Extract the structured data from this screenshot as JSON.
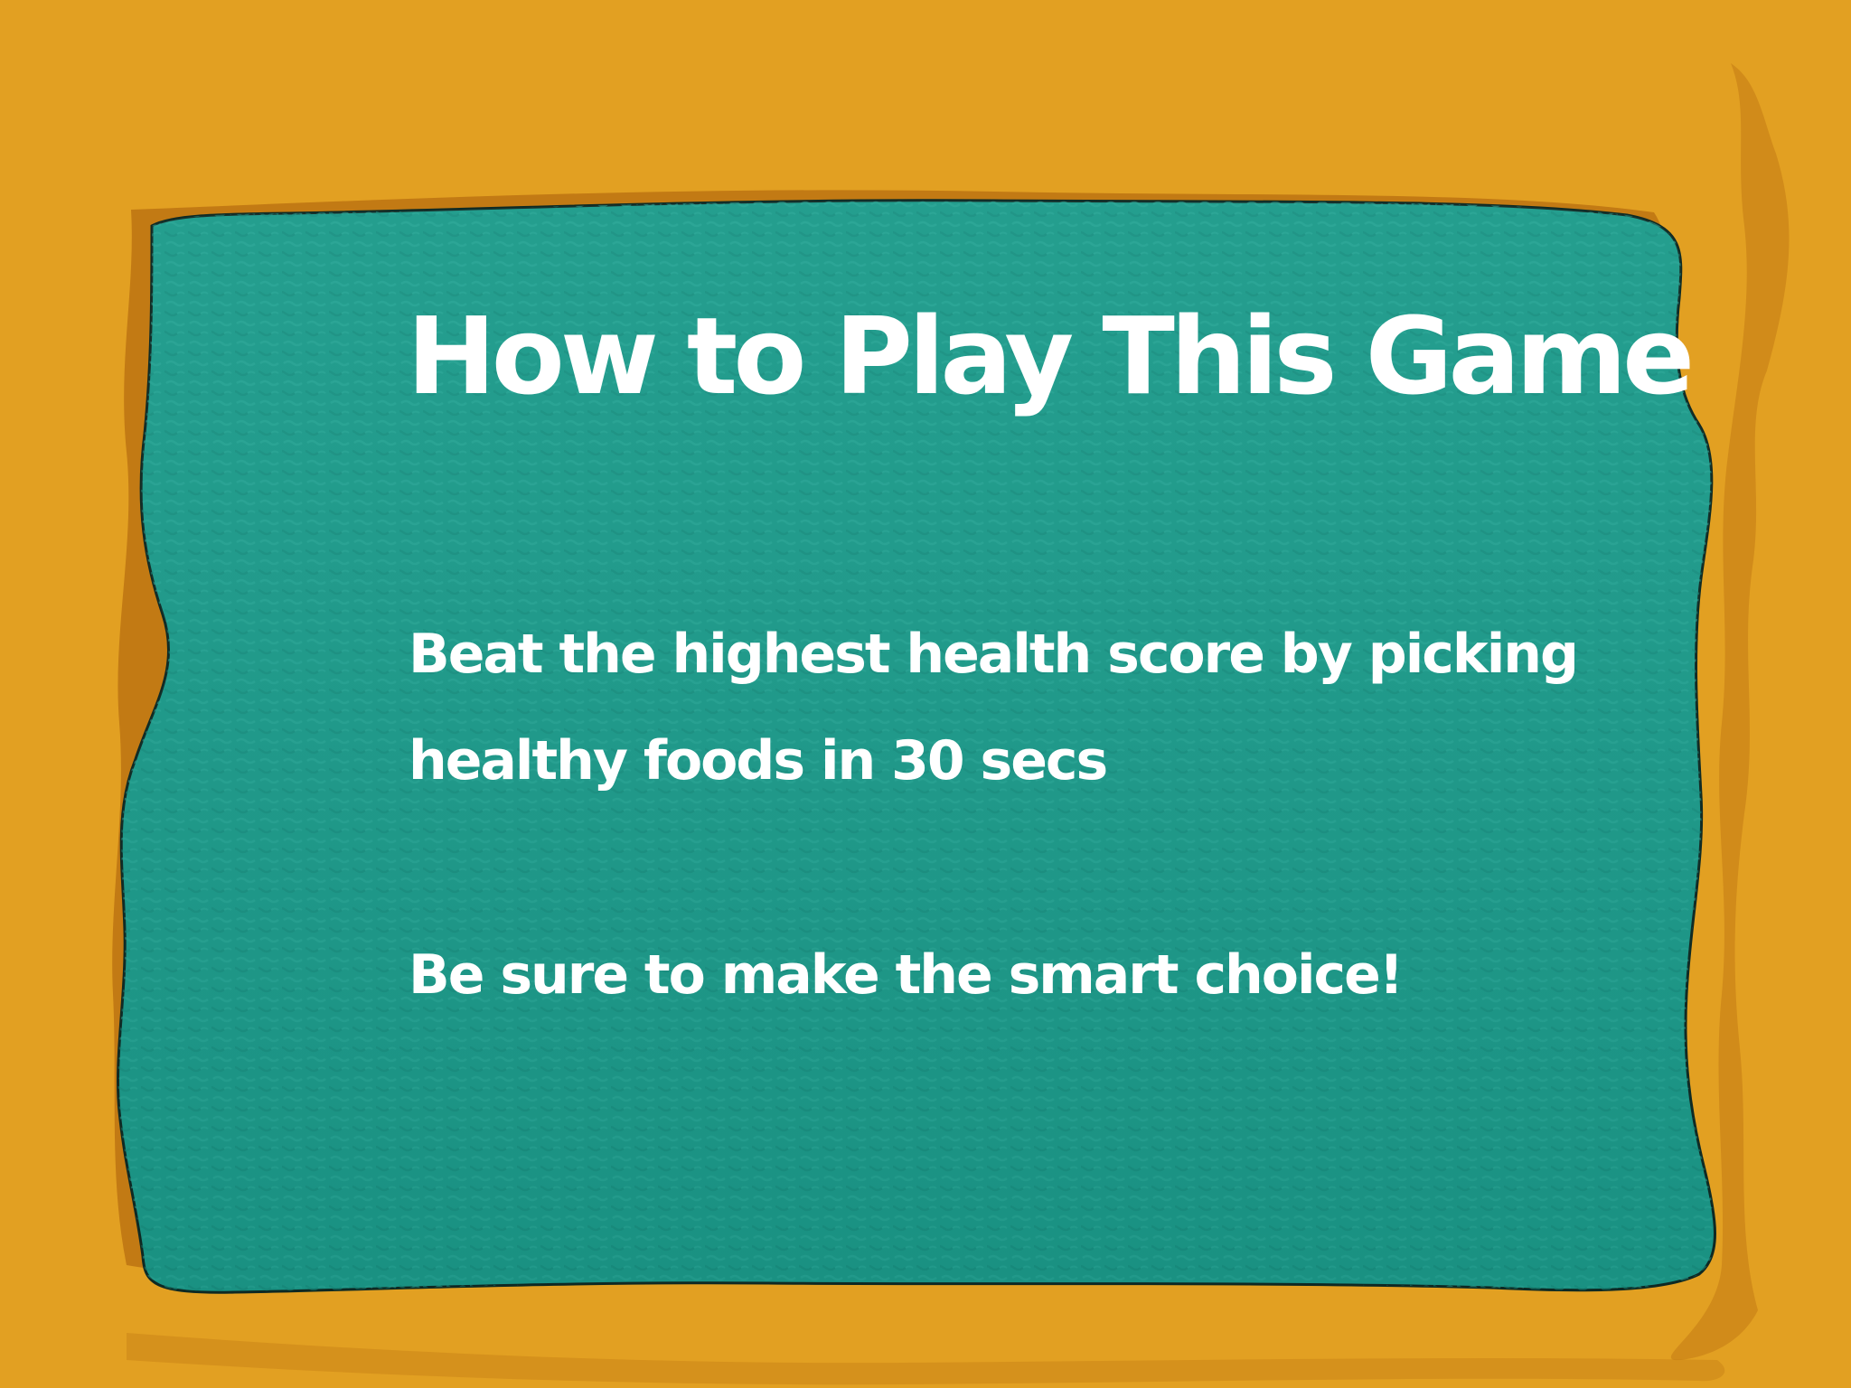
{
  "colors": {
    "background": "#e2a022",
    "frame_shadow": "#c27a14",
    "board": "#1b9a8a",
    "board_outline": "#0e2a24",
    "text": "#ffffff"
  },
  "board": {
    "title": "How to Play This Game",
    "instructions": [
      "Beat the highest health score by picking healthy foods in 30 secs",
      "Be sure to make the smart choice!"
    ]
  }
}
